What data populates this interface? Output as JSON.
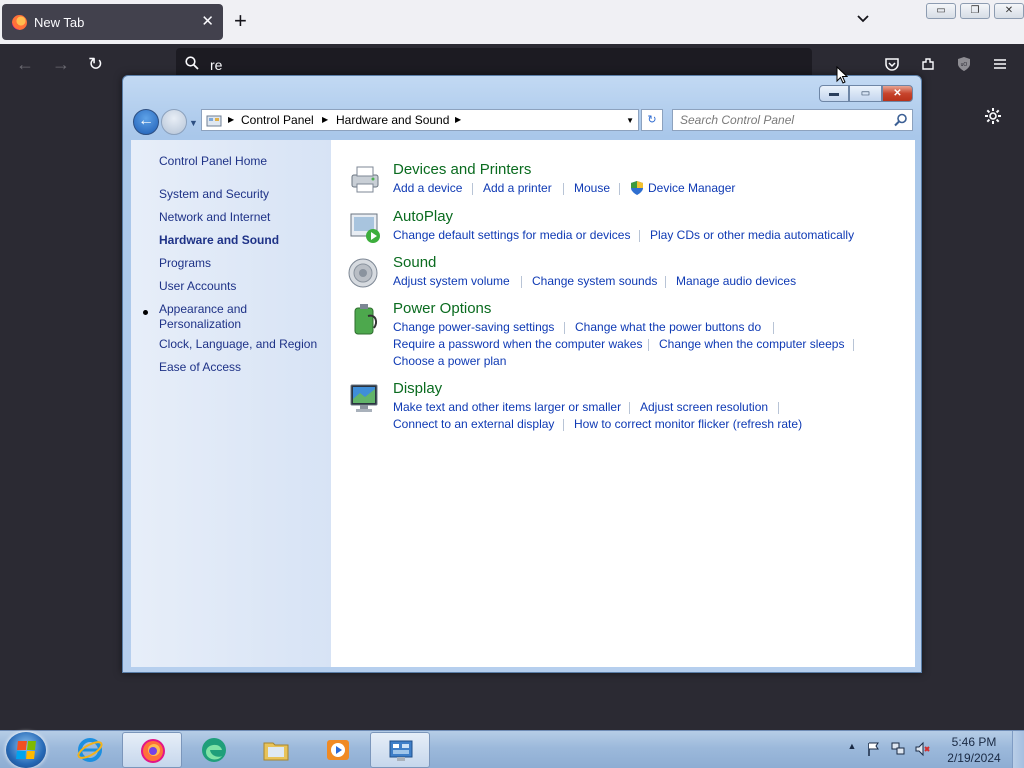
{
  "browser": {
    "tab": {
      "title": "New Tab",
      "close": "✕"
    },
    "new_tab": "+",
    "urlbar": {
      "value": "re"
    },
    "window_buttons": {
      "minimize": "▭",
      "restore": "❐",
      "close": "✕"
    }
  },
  "control_panel": {
    "caption": {
      "minimize": "▬",
      "maximize": "▭",
      "close": "✕"
    },
    "breadcrumb": [
      "Control Panel",
      "Hardware and Sound"
    ],
    "search_placeholder": "Search Control Panel",
    "refresh_icon": "↻",
    "sidebar": {
      "home": "Control Panel Home",
      "items": [
        "System and Security",
        "Network and Internet",
        "Hardware and Sound",
        "Programs",
        "User Accounts",
        "Appearance and Personalization",
        "Clock, Language, and Region",
        "Ease of Access"
      ],
      "current_index": 2
    },
    "categories": [
      {
        "title": "Devices and Printers",
        "icon": "printer-icon",
        "links": [
          "Add a device",
          "Add a printer",
          "Mouse",
          "Device Manager"
        ]
      },
      {
        "title": "AutoPlay",
        "icon": "autoplay-icon",
        "links": [
          "Change default settings for media or devices",
          "Play CDs or other media automatically"
        ]
      },
      {
        "title": "Sound",
        "icon": "speaker-icon",
        "links": [
          "Adjust system volume",
          "Change system sounds",
          "Manage audio devices"
        ]
      },
      {
        "title": "Power Options",
        "icon": "battery-icon",
        "links": [
          "Change power-saving settings",
          "Change what the power buttons do",
          "Require a password when the computer wakes",
          "Change when the computer sleeps",
          "Choose a power plan"
        ]
      },
      {
        "title": "Display",
        "icon": "monitor-icon",
        "links": [
          "Make text and other items larger or smaller",
          "Adjust screen resolution",
          "Connect to an external display",
          "How to correct monitor flicker (refresh rate)"
        ]
      }
    ]
  },
  "taskbar": {
    "clock": {
      "time": "5:46 PM",
      "date": "2/19/2024"
    },
    "tray_overflow": "▲"
  }
}
